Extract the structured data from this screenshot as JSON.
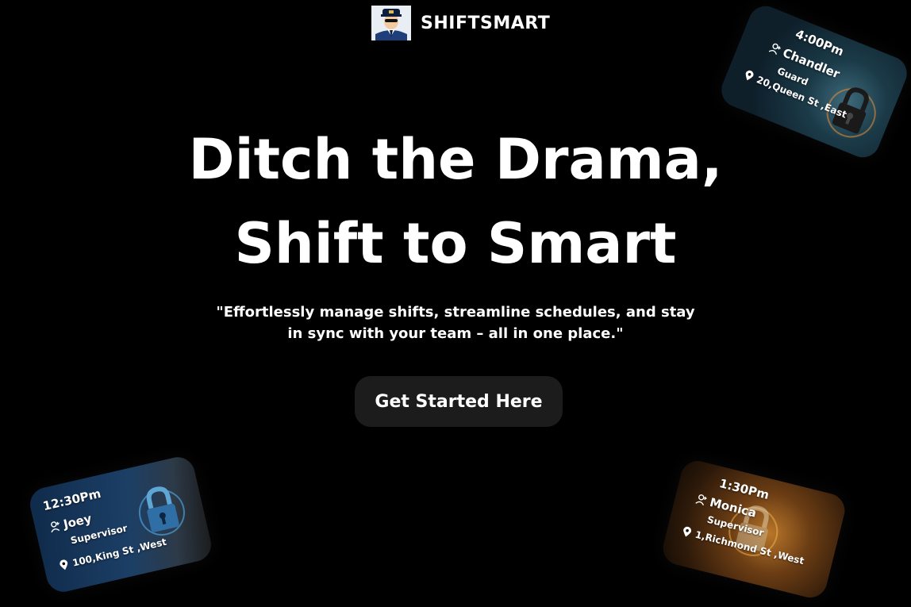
{
  "brand": {
    "name": "SHIFTSMART",
    "logo_icon": "security-guard-avatar-icon"
  },
  "hero": {
    "headline_line1": "Ditch the Drama,",
    "headline_line2": "Shift to Smart",
    "tagline_line1": "\"Effortlessly manage shifts, streamline schedules, and stay",
    "tagline_line2": "in sync with your team – all in one place.\"",
    "cta_label": "Get Started Here"
  },
  "cards": [
    {
      "time": "4:00Pm",
      "name": "Chandler",
      "role": "Guard",
      "address": "20,Queen St ,East",
      "theme": "#1b3a48"
    },
    {
      "time": "12:30Pm",
      "name": "Joey",
      "role": "Supervisor",
      "address": "100,King St ,West",
      "theme": "#1c3f66"
    },
    {
      "time": "1:30Pm",
      "name": "Monica",
      "role": "Supervisor",
      "address": "1,Richmond St ,West",
      "theme": "#6b3d14"
    }
  ],
  "colors": {
    "background": "#000000",
    "text": "#ffffff",
    "button_bg": "#1c1c1c"
  }
}
